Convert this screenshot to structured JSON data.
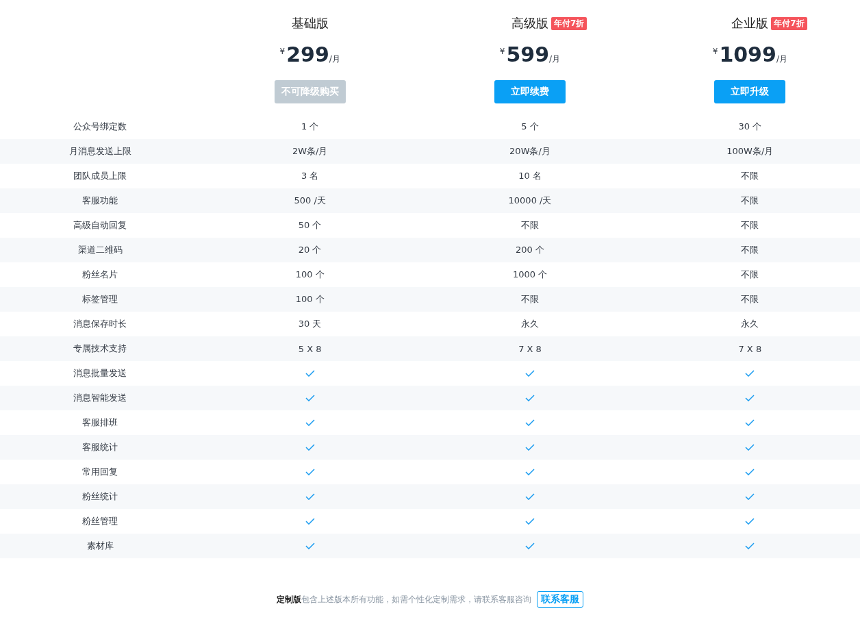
{
  "plans": [
    {
      "name": "基础版",
      "currency": "¥",
      "price": "299",
      "unit": "/月",
      "button": {
        "label": "不可降级购买",
        "disabled": true
      }
    },
    {
      "name": "高级版",
      "badge": "年付7折",
      "currency": "¥",
      "price": "599",
      "unit": "/月",
      "button": {
        "label": "立即续费",
        "disabled": false
      }
    },
    {
      "name": "企业版",
      "badge": "年付7折",
      "currency": "¥",
      "price": "1099",
      "unit": "/月",
      "button": {
        "label": "立即升级",
        "disabled": false
      }
    }
  ],
  "features": [
    {
      "kind": "text",
      "name": "公众号绑定数",
      "values": [
        "1 个",
        "5 个",
        "30 个"
      ]
    },
    {
      "kind": "text",
      "name": "月消息发送上限",
      "values": [
        "2W条/月",
        "20W条/月",
        "100W条/月"
      ]
    },
    {
      "kind": "text",
      "name": "团队成员上限",
      "values": [
        "3 名",
        "10 名",
        "不限"
      ]
    },
    {
      "kind": "text",
      "name": "客服功能",
      "values": [
        "500 /天",
        "10000 /天",
        "不限"
      ]
    },
    {
      "kind": "text",
      "name": "高级自动回复",
      "values": [
        "50 个",
        "不限",
        "不限"
      ]
    },
    {
      "kind": "text",
      "name": "渠道二维码",
      "values": [
        "20 个",
        "200 个",
        "不限"
      ]
    },
    {
      "kind": "text",
      "name": "粉丝名片",
      "values": [
        "100 个",
        "1000 个",
        "不限"
      ]
    },
    {
      "kind": "text",
      "name": "标签管理",
      "values": [
        "100 个",
        "不限",
        "不限"
      ]
    },
    {
      "kind": "text",
      "name": "消息保存时长",
      "values": [
        "30 天",
        "永久",
        "永久"
      ]
    },
    {
      "kind": "text",
      "name": "专属技术支持",
      "values": [
        "5 X 8",
        "7 X 8",
        "7 X 8"
      ]
    },
    {
      "kind": "check",
      "name": "消息批量发送",
      "included": [
        true,
        true,
        true
      ]
    },
    {
      "kind": "check",
      "name": "消息智能发送",
      "included": [
        true,
        true,
        true
      ]
    },
    {
      "kind": "check",
      "name": "客服排班",
      "included": [
        true,
        true,
        true
      ]
    },
    {
      "kind": "check",
      "name": "客服统计",
      "included": [
        true,
        true,
        true
      ]
    },
    {
      "kind": "check",
      "name": "常用回复",
      "included": [
        true,
        true,
        true
      ]
    },
    {
      "kind": "check",
      "name": "粉丝统计",
      "included": [
        true,
        true,
        true
      ]
    },
    {
      "kind": "check",
      "name": "粉丝管理",
      "included": [
        true,
        true,
        true
      ]
    },
    {
      "kind": "check",
      "name": "素材库",
      "included": [
        true,
        true,
        true
      ]
    }
  ],
  "footer": {
    "text": "**定制版**包含上述版本所有功能，如需个性化定制需求，请联系客服咨询",
    "button": "联系客服"
  }
}
